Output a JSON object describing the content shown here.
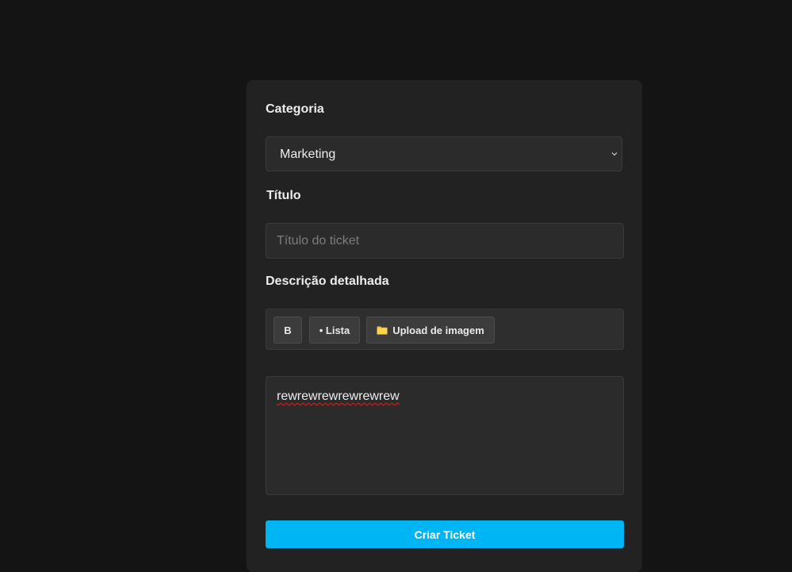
{
  "form": {
    "category_label": "Categoria",
    "category_value": "Marketing",
    "title_label": "Título",
    "title_placeholder": "Título do ticket",
    "title_value": "",
    "description_label": "Descrição detalhada",
    "toolbar": {
      "bold_label": "B",
      "list_label": "• Lista",
      "upload_label": "Upload de imagem",
      "upload_icon": "folder-icon"
    },
    "description_value": "rewrewrewrewrewrew",
    "submit_label": "Criar Ticket"
  },
  "colors": {
    "background": "#141414",
    "card": "#222222",
    "accent": "#00b5f3",
    "folder_icon": "#f4c430"
  }
}
